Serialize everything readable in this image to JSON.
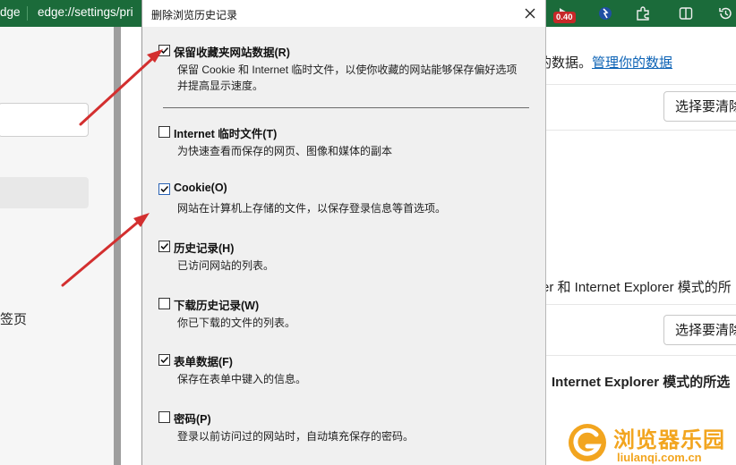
{
  "browser": {
    "tab_text_left": "dge",
    "address_text": "edge://settings/pri",
    "badge_value": "0.40"
  },
  "left_pane": {
    "tab_label": "签页"
  },
  "right_pane": {
    "data_text": "的数据。",
    "manage_link": "管理你的数据",
    "choose_button_1": "选择要清除",
    "ie_text": "er 和 Internet Explorer 模式的所",
    "choose_button_2": "选择要清除",
    "ie_bold_text": "Internet Explorer 模式的所选"
  },
  "dialog": {
    "title": "删除浏览历史记录",
    "options": [
      {
        "label": "保留收藏夹网站数据(R)",
        "desc": "保留 Cookie 和 Internet 临时文件，以使你收藏的网站能够保存偏好选项并提高显示速度。",
        "checked": true
      },
      {
        "label": "Internet 临时文件(T)",
        "desc": "为快速查看而保存的网页、图像和媒体的副本",
        "checked": false
      },
      {
        "label": "Cookie(O)",
        "desc": "网站在计算机上存储的文件，以保存登录信息等首选项。",
        "checked": true
      },
      {
        "label": "历史记录(H)",
        "desc": "已访问网站的列表。",
        "checked": true
      },
      {
        "label": "下载历史记录(W)",
        "desc": "你已下载的文件的列表。",
        "checked": false
      },
      {
        "label": "表单数据(F)",
        "desc": "保存在表单中键入的信息。",
        "checked": true
      },
      {
        "label": "密码(P)",
        "desc": "登录以前访问过的网站时，自动填充保存的密码。",
        "checked": false
      }
    ]
  },
  "watermark": {
    "title": "浏览器乐园",
    "subtitle": "liulanqi.com.cn"
  },
  "colors": {
    "browser_bar": "#1b6b3a",
    "arrow": "#d32f2f",
    "link": "#0d63b6",
    "watermark": "#f2a51f"
  },
  "icons": [
    "close-icon",
    "checkmark-icon",
    "extensions-icon",
    "split-screen-icon",
    "history-icon",
    "sync-icon"
  ]
}
